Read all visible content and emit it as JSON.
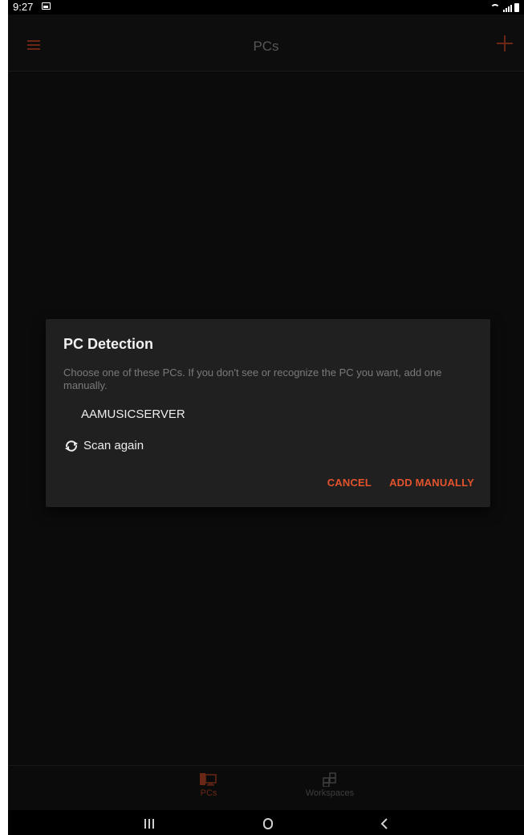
{
  "status_bar": {
    "time": "9:27"
  },
  "app_bar": {
    "title": "PCs"
  },
  "dialog": {
    "title": "PC Detection",
    "message": "Choose one of these PCs. If you don't see or recognize the PC you want, add one manually.",
    "pcs": [
      "AAMUSICSERVER"
    ],
    "scan_label": "Scan again",
    "cancel_label": "CANCEL",
    "add_label": "ADD MANUALLY"
  },
  "bottom_nav": {
    "items": [
      {
        "label": "PCs",
        "icon": "monitor-icon",
        "active": true
      },
      {
        "label": "Workspaces",
        "icon": "workspaces-grid-icon",
        "active": false
      }
    ]
  },
  "colors": {
    "accent": "#e2532d",
    "accent_dimmed": "#6a2716",
    "dialog_bg": "#202020",
    "screen_bg": "#0b0b0b"
  }
}
